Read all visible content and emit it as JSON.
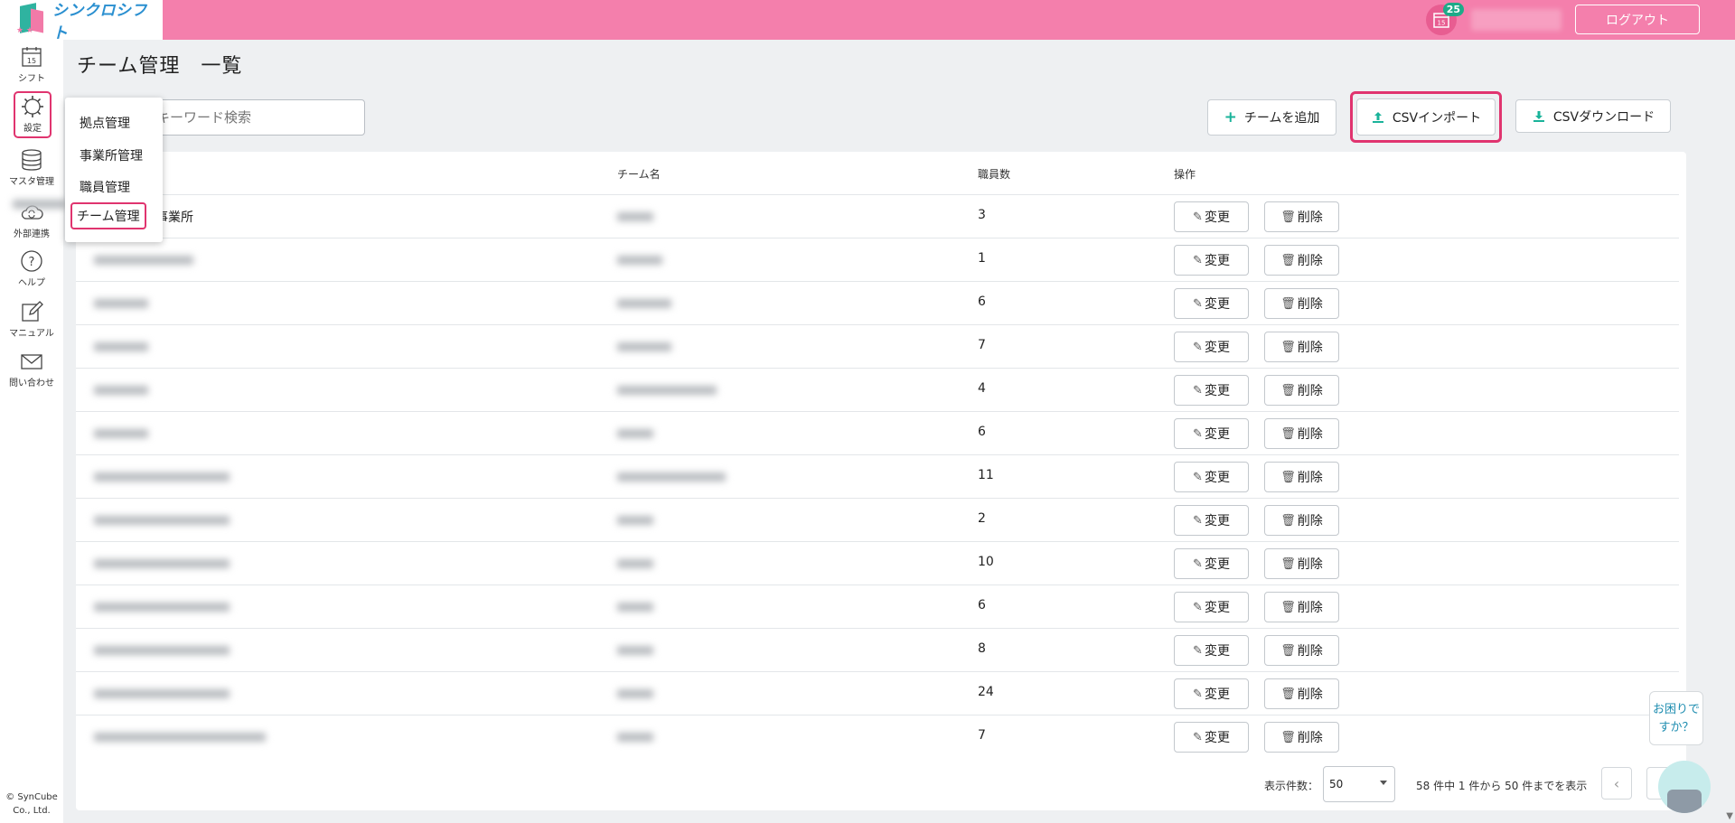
{
  "header": {
    "app_name": "シンクロシフト",
    "notification_date": "15",
    "notification_count": "25",
    "logout_label": "ログアウト"
  },
  "sidebar": {
    "items": [
      {
        "label": "シフト",
        "icon": "calendar-icon"
      },
      {
        "label": "設定",
        "icon": "gear-icon"
      },
      {
        "label": "マスタ管理",
        "icon": "database-icon"
      },
      {
        "label": "外部連携",
        "icon": "cloud-sync-icon"
      },
      {
        "label": "ヘルプ",
        "icon": "help-circle-icon"
      },
      {
        "label": "マニュアル",
        "icon": "edit-note-icon"
      },
      {
        "label": "問い合わせ",
        "icon": "mail-icon"
      }
    ],
    "calendar_day": "15",
    "copyright_1": "© SynCube",
    "copyright_2": "Co., Ltd."
  },
  "page": {
    "title": "チーム管理　一覧",
    "search_placeholder": "キーワード検索"
  },
  "settings_menu": {
    "items": [
      "拠点管理",
      "事業所管理",
      "職員管理",
      "チーム管理"
    ],
    "active": "チーム管理"
  },
  "actions": {
    "add_team": "チームを追加",
    "csv_import": "CSVインポート",
    "csv_download": "CSVダウンロード"
  },
  "table": {
    "headers": {
      "team_name": "チーム名",
      "staff_count": "職員数",
      "operation": "操作"
    },
    "edit_label": "変更",
    "delete_label": "削除",
    "rows": [
      {
        "office": "事業所",
        "staff": "3"
      },
      {
        "office": "",
        "staff": "1"
      },
      {
        "office": "",
        "staff": "6"
      },
      {
        "office": "",
        "staff": "7"
      },
      {
        "office": "",
        "staff": "4"
      },
      {
        "office": "",
        "staff": "6"
      },
      {
        "office": "",
        "staff": "11"
      },
      {
        "office": "",
        "staff": "2"
      },
      {
        "office": "",
        "staff": "10"
      },
      {
        "office": "",
        "staff": "6"
      },
      {
        "office": "",
        "staff": "8"
      },
      {
        "office": "",
        "staff": "24"
      },
      {
        "office": "",
        "staff": "7"
      }
    ]
  },
  "pager": {
    "per_page_label": "表示件数：",
    "per_page_value": "50",
    "info": "58 件中 1 件から 50 件までを表示"
  },
  "help": {
    "line1": "お困りで",
    "line2": "すか？"
  },
  "colors": {
    "header": "#f47fac",
    "highlight": "#e0346f",
    "accent": "#1ab39a"
  }
}
